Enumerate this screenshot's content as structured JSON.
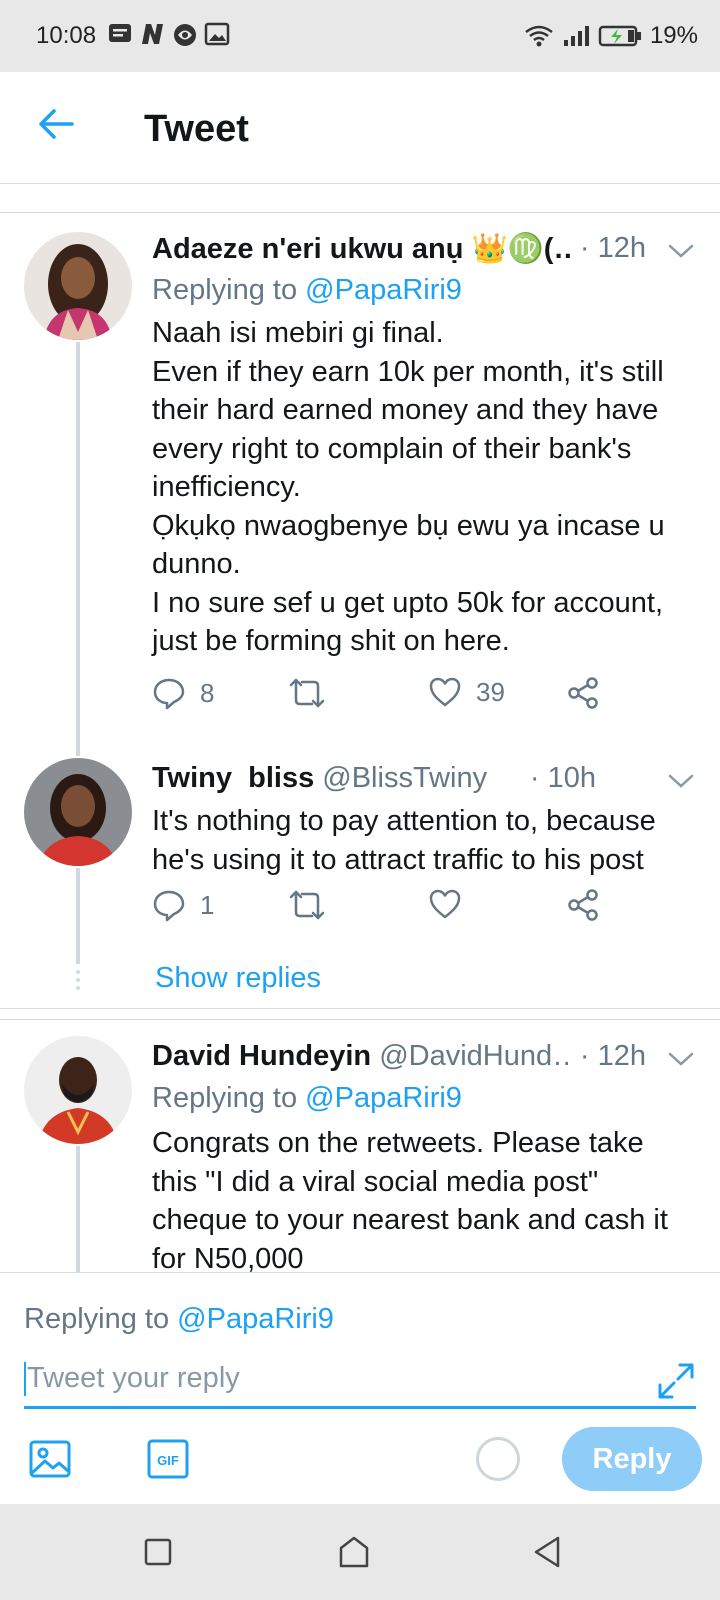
{
  "status_bar": {
    "time": "10:08",
    "battery_pct": "19%",
    "icons_left": [
      "notification-icon",
      "n-app-icon",
      "browser-icon",
      "gallery-icon"
    ],
    "icons_right": [
      "wifi-icon",
      "signal-icon",
      "battery-charging-icon"
    ]
  },
  "header": {
    "title": "Tweet"
  },
  "tweets": [
    {
      "name": "Adaeze n'eri ukwu anụ",
      "name_suffix": " 👑♍(…",
      "handle": "",
      "time": "· 12h",
      "replying_prefix": "Replying to ",
      "replying_mention": "@PapaRiri9",
      "body": [
        "Naah isi mebiri gi final.",
        "Even if they earn 10k per month, it's still",
        "their hard earned money and they have",
        "every right to complain of their bank's",
        "inefficiency.",
        "Ọkụkọ nwaogbenye bụ ewu ya incase u",
        "dunno.",
        "I no sure sef u get upto 50k for account,",
        "just be forming shit on here."
      ],
      "replies": "8",
      "retweets": "",
      "likes": "39"
    },
    {
      "name": "Twiny  bliss",
      "handle": " @BlissTwiny",
      "time": "· 10h",
      "body": [
        "It's nothing to pay attention to, because",
        "he's using it to attract traffic to his post"
      ],
      "replies": "1",
      "retweets": "",
      "likes": "",
      "show_replies": "Show replies"
    },
    {
      "name": "David Hundeyin",
      "handle": " @DavidHund…",
      "time": "· 12h",
      "replying_prefix": "Replying to ",
      "replying_mention": "@PapaRiri9",
      "body": [
        "Congrats on the retweets. Please take",
        "this \"I did a viral social media post\"",
        "cheque to your nearest bank and cash it",
        "for N50,000"
      ]
    }
  ],
  "composer": {
    "replying_prefix": "Replying to ",
    "replying_mention": "@PapaRiri9",
    "placeholder": "Tweet your reply",
    "reply_label": "Reply",
    "gif_label": "GIF"
  },
  "colors": {
    "accent": "#1da1f2",
    "muted": "#657786",
    "reply_disabled": "#8ecdf8"
  }
}
